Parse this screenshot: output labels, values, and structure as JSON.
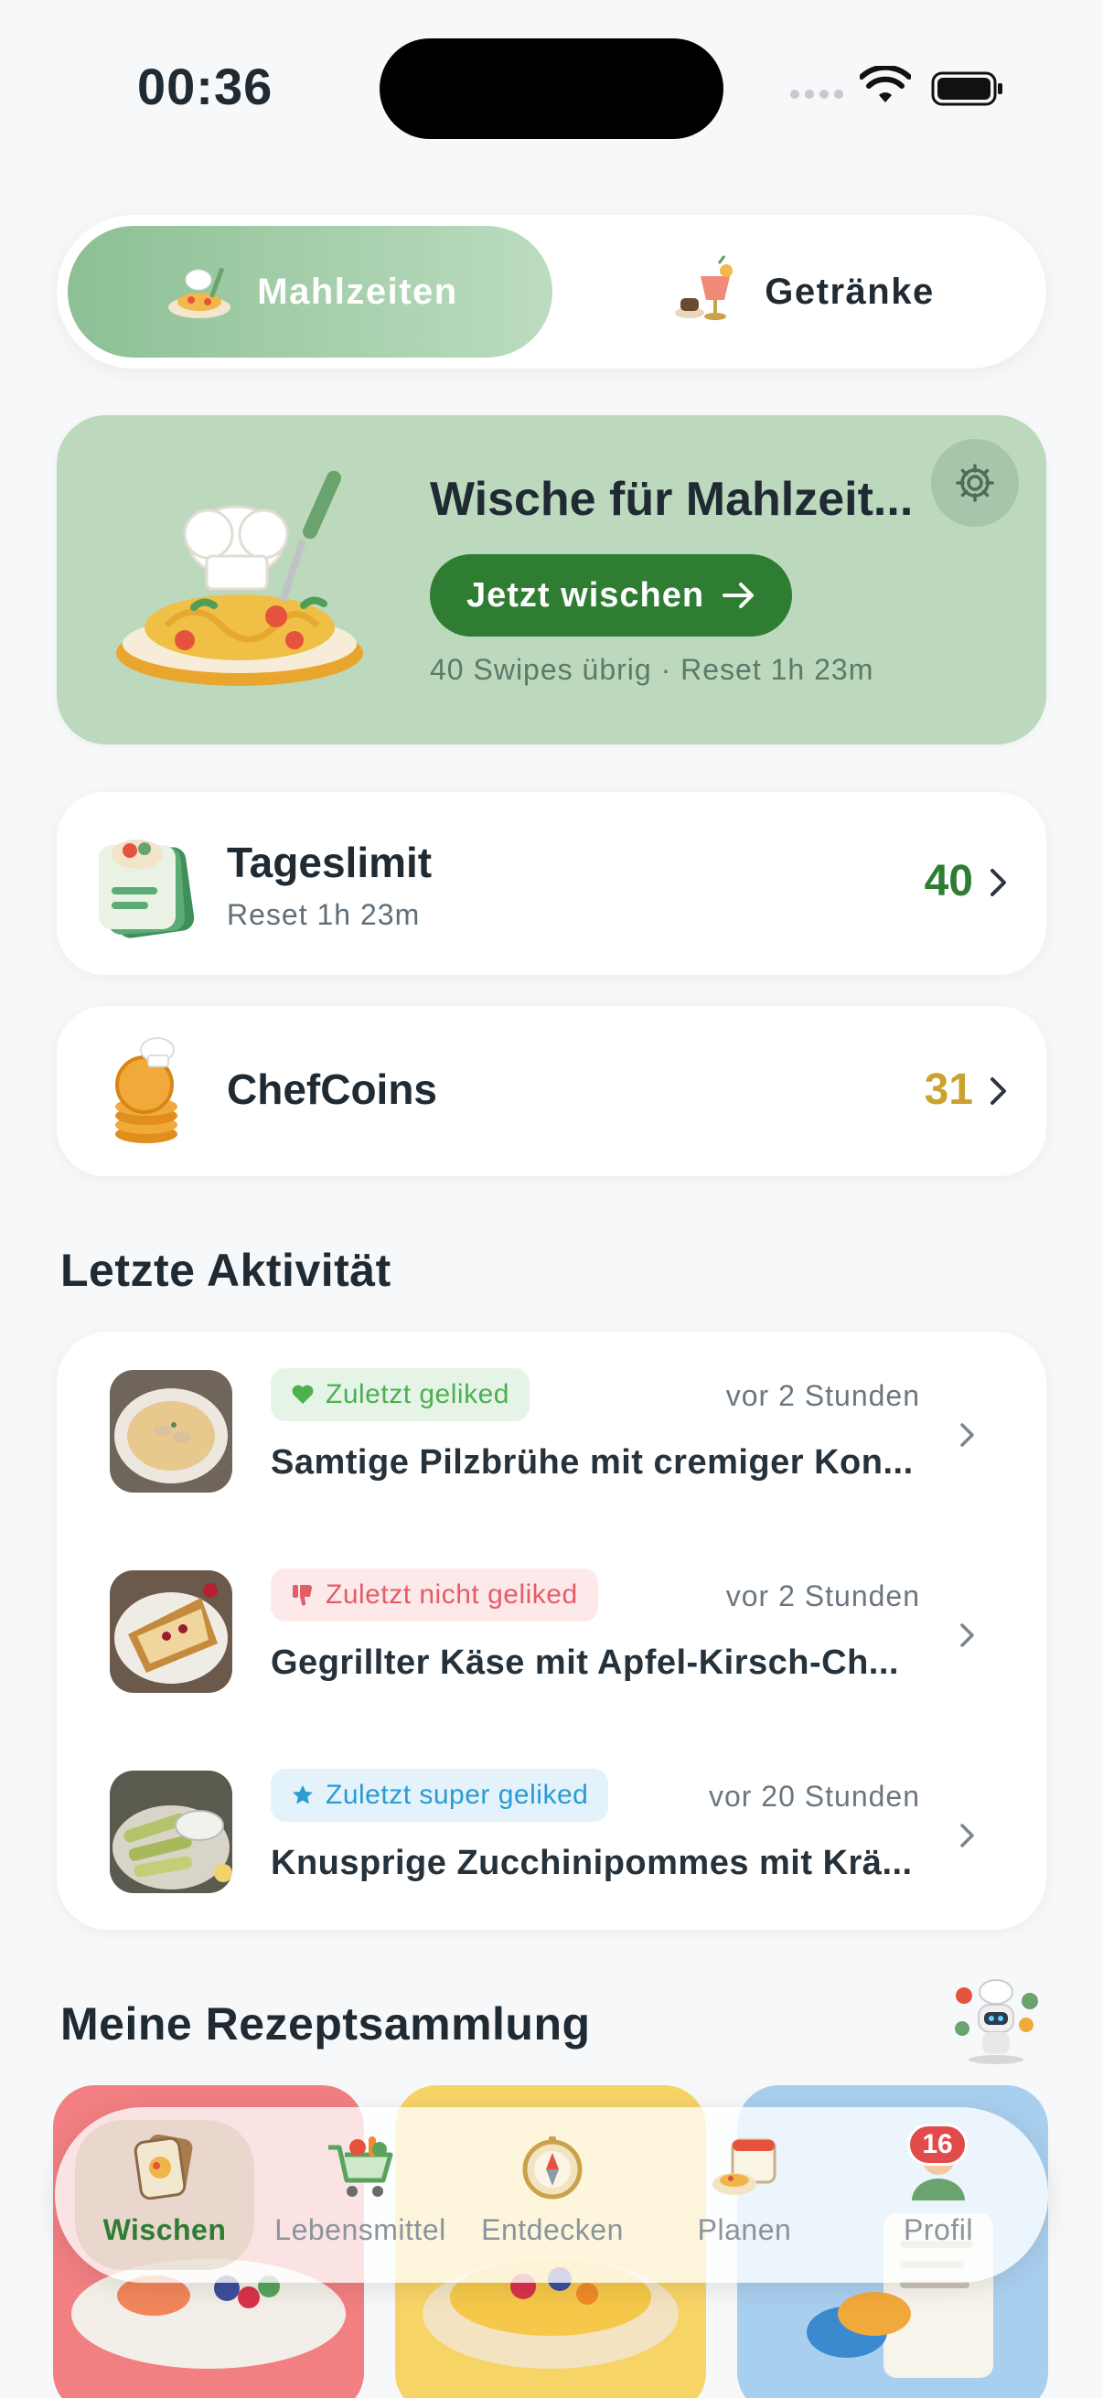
{
  "status_bar": {
    "time": "00:36"
  },
  "segment": {
    "active_label": "Mahlzeiten",
    "inactive_label": "Getränke"
  },
  "hero": {
    "title": "Wische für Mahlzeit...",
    "cta_label": "Jetzt wischen",
    "subtitle": "40 Swipes übrig · Reset 1h 23m"
  },
  "daily_limit": {
    "title": "Tageslimit",
    "subtitle": "Reset 1h 23m",
    "value": "40"
  },
  "chefcoins": {
    "title": "ChefCoins",
    "value": "31"
  },
  "activity": {
    "section_title": "Letzte Aktivität",
    "items": [
      {
        "badge": "Zuletzt geliked",
        "time": "vor 2 Stunden",
        "title": "Samtige Pilzbrühe mit cremiger Kon..."
      },
      {
        "badge": "Zuletzt nicht geliked",
        "time": "vor 2 Stunden",
        "title": "Gegrillter Käse mit Apfel-Kirsch-Ch..."
      },
      {
        "badge": "Zuletzt super geliked",
        "time": "vor 20 Stunden",
        "title": "Knusprige Zucchinipommes mit Krä..."
      }
    ]
  },
  "collection": {
    "section_title": "Meine Rezeptsammlung"
  },
  "tabbar": {
    "tabs": [
      {
        "label": "Wischen"
      },
      {
        "label": "Lebensmittel"
      },
      {
        "label": "Entdecken"
      },
      {
        "label": "Planen"
      },
      {
        "label": "Profil"
      }
    ],
    "profile_badge": "16"
  },
  "colors": {
    "accent": "#2e7d32",
    "hero_bg": "#bcd9be",
    "coins": "#c9a230",
    "liked": "#4caf50",
    "disliked": "#e35d67",
    "super_liked": "#2a9bd3"
  }
}
